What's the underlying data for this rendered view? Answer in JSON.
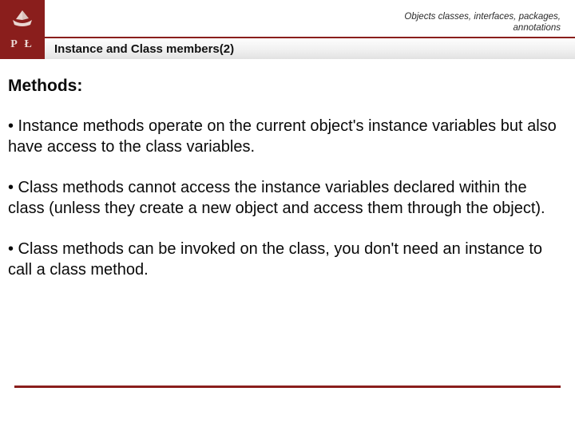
{
  "colors": {
    "brand": "#8a1e1c"
  },
  "header": {
    "breadcrumb_line1": "Objects classes, interfaces, packages,",
    "breadcrumb_line2": "annotations",
    "logo_letters": "P Ł",
    "title": "Instance and Class members(2)"
  },
  "content": {
    "heading": "Methods:",
    "bullets": [
      "• Instance methods operate on the current object's instance variables but also have access to the class variables.",
      "• Class methods cannot access the instance variables declared within the class (unless they create a new object and access them through the object).",
      "• Class methods can be invoked on the class, you don't need an instance to call a class method."
    ]
  }
}
